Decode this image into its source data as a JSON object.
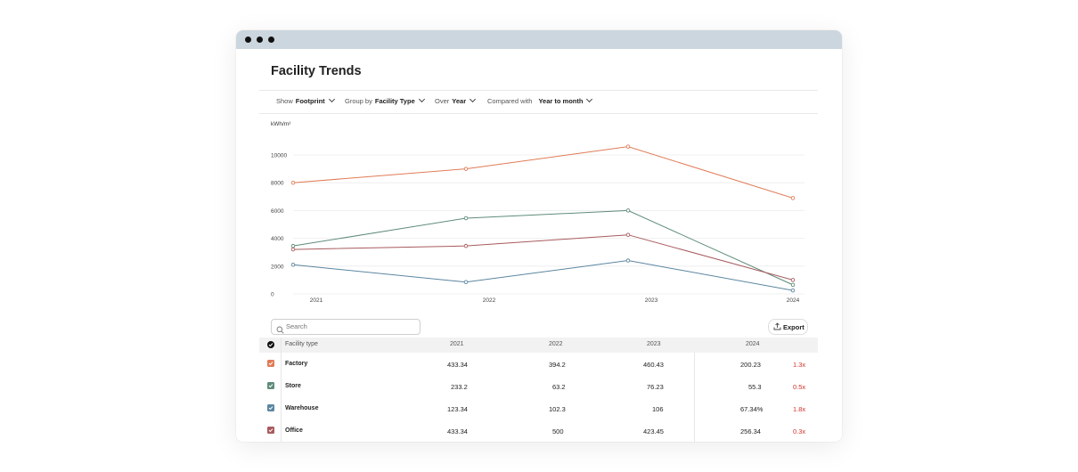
{
  "page": {
    "title": "Facility Trends"
  },
  "filters": {
    "show": {
      "label": "Show",
      "value": "Footprint"
    },
    "group": {
      "label": "Group by",
      "value": "Facility Type"
    },
    "over": {
      "label": "Over",
      "value": "Year"
    },
    "compare": {
      "label": "Compared with",
      "value": "Year to month"
    }
  },
  "chart_data": {
    "type": "line",
    "ylabel": "kWh/m²",
    "x": [
      "2021",
      "2022",
      "2023",
      "2024"
    ],
    "ylim": [
      0,
      11000
    ],
    "yticks": [
      0,
      2000,
      4000,
      6000,
      8000,
      10000
    ],
    "grid": true,
    "series": [
      {
        "color": "#e07b56",
        "values": [
          8000,
          9000,
          10600,
          6900
        ]
      },
      {
        "color": "#5f8c79",
        "values": [
          3450,
          5450,
          6000,
          650
        ]
      },
      {
        "color": "#a85a5e",
        "values": [
          3200,
          3450,
          4250,
          1000
        ]
      },
      {
        "color": "#5b86a0",
        "values": [
          2100,
          850,
          2400,
          250
        ]
      }
    ]
  },
  "toolbar": {
    "search_placeholder": "Search",
    "export_label": "Export",
    "search_icon": "search-icon",
    "export_icon": "upload-icon"
  },
  "table": {
    "headers": [
      "Facility type",
      "2021",
      "2022",
      "2023",
      "2024"
    ],
    "rows": [
      {
        "name": "Factory",
        "color": "#e07b56",
        "v2021": "433.34",
        "v2022": "394.2",
        "v2023": "460.43",
        "v2024": "200.23",
        "ratio": "1.3x"
      },
      {
        "name": "Store",
        "color": "#5f8c79",
        "v2021": "233.2",
        "v2022": "63.2",
        "v2023": "76.23",
        "v2024": "55.3",
        "ratio": "0.5x"
      },
      {
        "name": "Warehouse",
        "color": "#5b86a0",
        "v2021": "123.34",
        "v2022": "102.3",
        "v2023": "106",
        "v2024": "67.34%",
        "ratio": "1.8x"
      },
      {
        "name": "Office",
        "color": "#a85a5e",
        "v2021": "433.34",
        "v2022": "500",
        "v2023": "423.45",
        "v2024": "256.34",
        "ratio": "0.3x"
      }
    ],
    "header_checkbox_color": "#111111"
  }
}
